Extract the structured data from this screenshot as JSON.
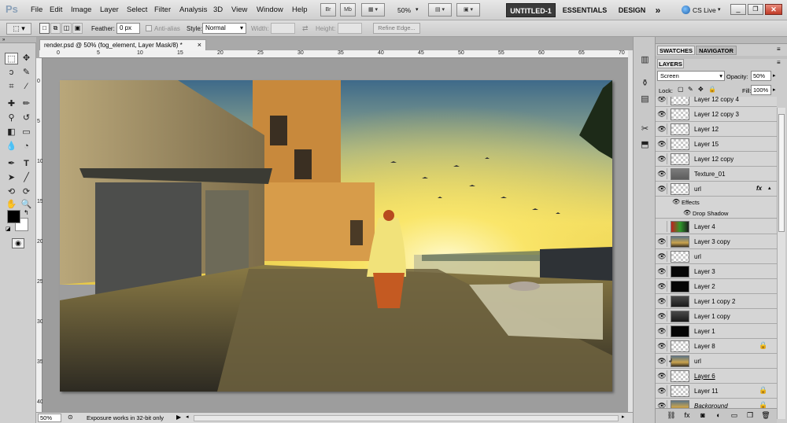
{
  "app": {
    "logo": "Ps"
  },
  "menu": [
    "File",
    "Edit",
    "Image",
    "Layer",
    "Select",
    "Filter",
    "Analysis",
    "3D",
    "View",
    "Window",
    "Help"
  ],
  "app_bar": {
    "zoom": "50%",
    "bridge_label": "Br",
    "mini_bridge_label": "Mb",
    "workspaces": [
      "UNTITLED-1",
      "ESSENTIALS",
      "DESIGN"
    ],
    "more": "»",
    "cs_live": "CS Live",
    "cs_live_arrow": "▾"
  },
  "options": {
    "feather_label": "Feather:",
    "feather_value": "0 px",
    "antialias_label": "Anti-alias",
    "style_label": "Style:",
    "style_value": "Normal",
    "width_label": "Width:",
    "height_label": "Height:",
    "refine_edge": "Refine Edge..."
  },
  "document": {
    "tab_title": "render.psd @ 50% (fog_element, Layer Mask/8) *",
    "tab_close": "×",
    "ruler_top": [
      "0",
      "5",
      "10",
      "15",
      "20",
      "25",
      "30",
      "35",
      "40",
      "45",
      "50",
      "55",
      "60",
      "65",
      "70"
    ],
    "ruler_left": [
      "0",
      "5",
      "10",
      "15",
      "20",
      "25",
      "30",
      "35",
      "40"
    ],
    "status_zoom": "50%",
    "status_info": "Exposure works in 32-bit only"
  },
  "layers_panel": {
    "tabs": [
      "SWATCHES",
      "NAVIGATOR"
    ],
    "layers_tab": "LAYERS",
    "blend_mode": "Screen",
    "opacity_label": "Opacity:",
    "opacity_value": "50%",
    "lock_label": "Lock:",
    "fill_label": "Fill:",
    "fill_value": "100%",
    "layers": [
      {
        "name": "Layer 12 copy 4",
        "thumb": "checker",
        "visible": true
      },
      {
        "name": "Layer 12 copy 3",
        "thumb": "checker",
        "visible": true
      },
      {
        "name": "Layer 12",
        "thumb": "checker",
        "visible": true
      },
      {
        "name": "Layer 15",
        "thumb": "checker",
        "visible": true
      },
      {
        "name": "Layer 12 copy",
        "thumb": "checker",
        "visible": true
      },
      {
        "name": "Texture_01",
        "thumb": "texture",
        "visible": true
      },
      {
        "name": "url",
        "thumb": "checker",
        "visible": true,
        "fx": "fx"
      },
      {
        "name": "Layer 4",
        "thumb": "rgb",
        "visible": false
      },
      {
        "name": "Layer 3 copy",
        "thumb": "photo",
        "visible": true
      },
      {
        "name": "url",
        "thumb": "checker",
        "visible": true
      },
      {
        "name": "Layer 3",
        "thumb": "black",
        "visible": true
      },
      {
        "name": "Layer 2",
        "thumb": "black",
        "visible": true
      },
      {
        "name": "Layer 1 copy 2",
        "thumb": "dark",
        "visible": true
      },
      {
        "name": "Layer 1 copy",
        "thumb": "dark",
        "visible": true
      },
      {
        "name": "Layer 1",
        "thumb": "black",
        "visible": true
      },
      {
        "name": "Layer 8",
        "thumb": "checker",
        "visible": true,
        "locked": true
      },
      {
        "name": "url",
        "thumb": "photo",
        "visible": true,
        "linked": true
      },
      {
        "name": "Layer 6",
        "thumb": "checker",
        "visible": true,
        "underline": true
      },
      {
        "name": "Layer 11",
        "thumb": "checker",
        "visible": true,
        "locked": true
      },
      {
        "name": "Background",
        "thumb": "photo",
        "visible": true,
        "locked": true,
        "italic": true
      }
    ],
    "effects_label": "Effects",
    "drop_shadow_label": "Drop Shadow"
  },
  "colors": {
    "accent_workspace": "#3a3a3a",
    "panel_bg": "#cccccc",
    "canvas_bg": "#9d9d9d"
  }
}
